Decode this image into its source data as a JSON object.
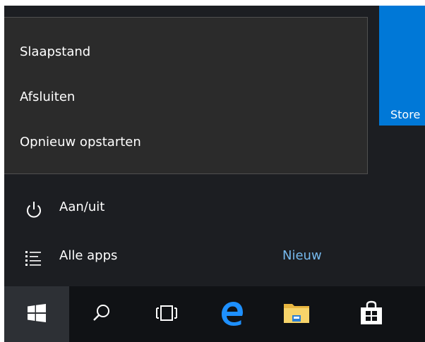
{
  "power_menu": {
    "items": [
      {
        "label": "Slaapstand"
      },
      {
        "label": "Afsluiten"
      },
      {
        "label": "Opnieuw opstarten"
      }
    ]
  },
  "start_menu": {
    "power_label": "Aan/uit",
    "power_icon": "power-icon",
    "all_apps_label": "Alle apps",
    "all_apps_icon": "list-icon",
    "new_badge": "Nieuw"
  },
  "tiles": {
    "store_label": "Store"
  },
  "taskbar": {
    "buttons": [
      {
        "name": "start",
        "icon": "windows-logo-icon"
      },
      {
        "name": "search",
        "icon": "search-icon"
      },
      {
        "name": "task-view",
        "icon": "task-view-icon"
      },
      {
        "name": "edge",
        "icon": "edge-icon"
      },
      {
        "name": "file-explorer",
        "icon": "folder-icon"
      },
      {
        "name": "store",
        "icon": "store-bag-icon"
      }
    ]
  },
  "colors": {
    "accent": "#0078d7",
    "menu_bg": "#1c1e22",
    "flyout_bg": "#2b2b2b",
    "taskbar_bg": "#101215",
    "new_badge": "#76b9ed"
  }
}
